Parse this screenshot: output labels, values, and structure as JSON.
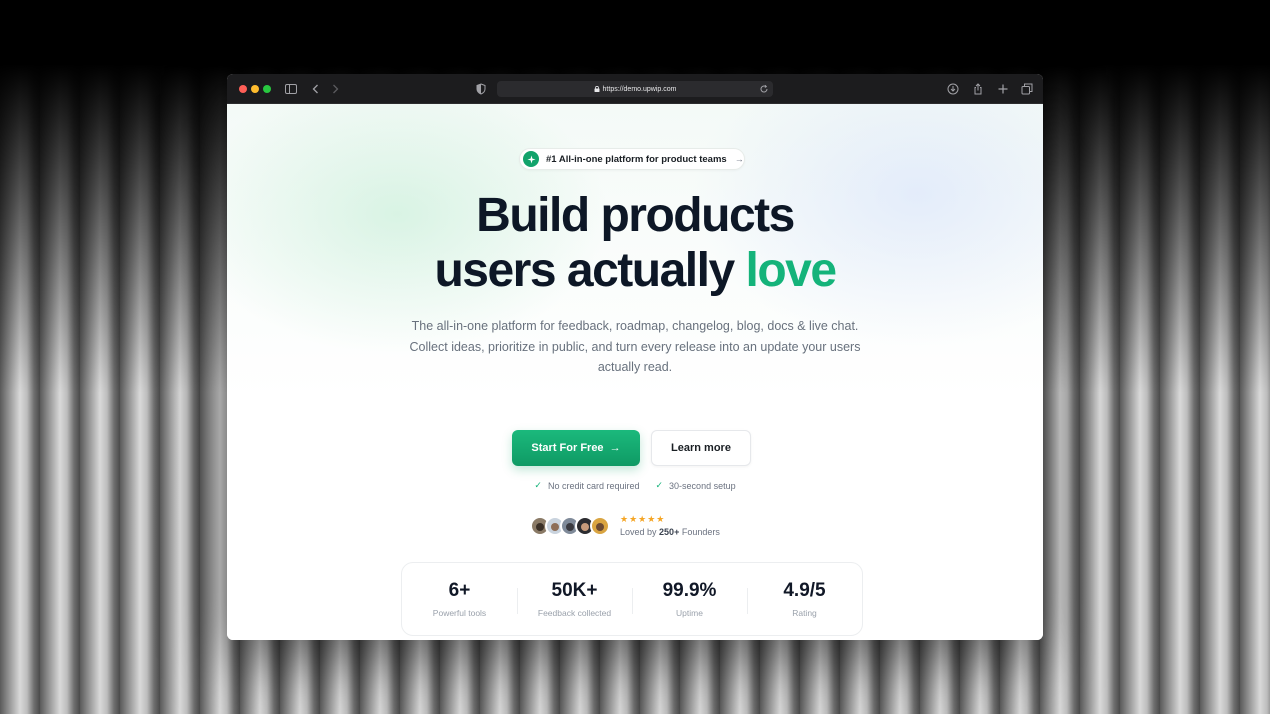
{
  "browser": {
    "url": "https://demo.upwip.com"
  },
  "badge": {
    "text": "#1 All-in-one platform for product teams",
    "arrow": "→"
  },
  "hero": {
    "line1": "Build products",
    "line2_prefix": "users actually",
    "line2_accent": "love",
    "subtitle": "The all-in-one platform for feedback, roadmap, changelog, blog, docs & live chat. Collect ideas, prioritize in public, and turn every release into an update your users actually read."
  },
  "cta": {
    "primary": "Start For Free",
    "secondary": "Learn more"
  },
  "checks": [
    "No credit card required",
    "30-second setup"
  ],
  "social_proof": {
    "stars": "★★★★★",
    "loved_prefix": "Loved by",
    "count": "250+",
    "loved_suffix": "Founders"
  },
  "stats": [
    {
      "value": "6+",
      "label": "Powerful tools"
    },
    {
      "value": "50K+",
      "label": "Feedback collected"
    },
    {
      "value": "99.9%",
      "label": "Uptime"
    },
    {
      "value": "4.9/5",
      "label": "Rating"
    }
  ],
  "colors": {
    "accent": "#14b37a",
    "primary_button": "#12a36b",
    "heading": "#0d1726",
    "star": "#f5a524"
  }
}
